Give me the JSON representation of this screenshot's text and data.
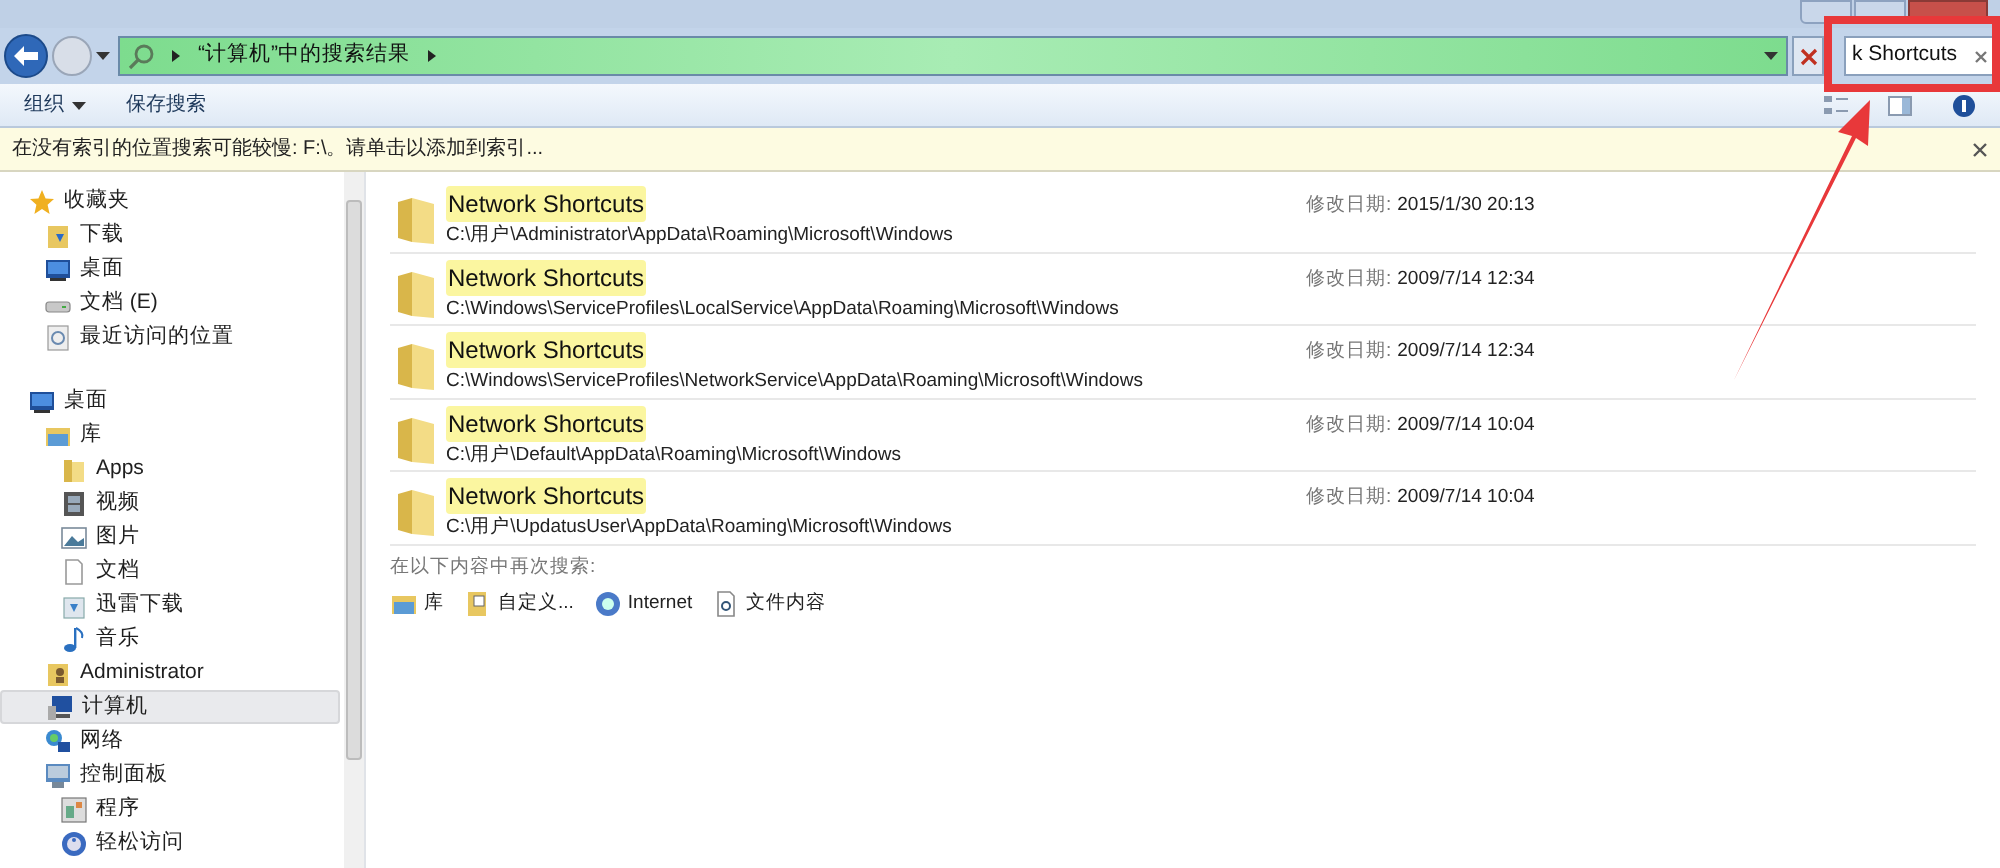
{
  "address_bar": {
    "breadcrumb": "“计算机”中的搜索结果"
  },
  "search": {
    "value": "k Shortcuts"
  },
  "toolbar": {
    "organize": "组织",
    "save_search": "保存搜索"
  },
  "info_bar": {
    "text": "在没有索引的位置搜索可能较慢: F:\\。请单击以添加到索引..."
  },
  "sidebar": {
    "items": [
      {
        "label": "收藏夹",
        "kind": "star",
        "selected": false,
        "children": [
          {
            "label": "下载",
            "kind": "download-folder",
            "selected": false
          },
          {
            "label": "桌面",
            "kind": "desktop",
            "selected": false
          },
          {
            "label": "文档 (E)",
            "kind": "drive",
            "selected": false
          },
          {
            "label": "最近访问的位置",
            "kind": "recent",
            "selected": false
          }
        ]
      },
      {
        "label": "桌面",
        "kind": "desktop",
        "selected": false,
        "children": [
          {
            "label": "库",
            "kind": "library",
            "selected": false,
            "children": [
              {
                "label": "Apps",
                "kind": "folder",
                "selected": false
              },
              {
                "label": "视频",
                "kind": "video",
                "selected": false
              },
              {
                "label": "图片",
                "kind": "picture",
                "selected": false
              },
              {
                "label": "文档",
                "kind": "document",
                "selected": false
              },
              {
                "label": "迅雷下载",
                "kind": "download",
                "selected": false
              },
              {
                "label": "音乐",
                "kind": "music",
                "selected": false
              }
            ]
          },
          {
            "label": "Administrator",
            "kind": "user",
            "selected": false
          },
          {
            "label": "计算机",
            "kind": "computer",
            "selected": true
          },
          {
            "label": "网络",
            "kind": "network",
            "selected": false
          },
          {
            "label": "控制面板",
            "kind": "control-panel",
            "selected": false,
            "children": [
              {
                "label": "程序",
                "kind": "program",
                "selected": false
              },
              {
                "label": "轻松访问",
                "kind": "accessibility",
                "selected": false
              }
            ]
          }
        ]
      }
    ]
  },
  "results": [
    {
      "name": "Network Shortcuts",
      "path": "C:\\用户\\Administrator\\AppData\\Roaming\\Microsoft\\Windows",
      "date_label": "修改日期:",
      "date": "2015/1/30 20:13"
    },
    {
      "name": "Network Shortcuts",
      "path": "C:\\Windows\\ServiceProfiles\\LocalService\\AppData\\Roaming\\Microsoft\\Windows",
      "date_label": "修改日期:",
      "date": "2009/7/14 12:34"
    },
    {
      "name": "Network Shortcuts",
      "path": "C:\\Windows\\ServiceProfiles\\NetworkService\\AppData\\Roaming\\Microsoft\\Windows",
      "date_label": "修改日期:",
      "date": "2009/7/14 12:34"
    },
    {
      "name": "Network Shortcuts",
      "path": "C:\\用户\\Default\\AppData\\Roaming\\Microsoft\\Windows",
      "date_label": "修改日期:",
      "date": "2009/7/14 10:04"
    },
    {
      "name": "Network Shortcuts",
      "path": "C:\\用户\\UpdatusUser\\AppData\\Roaming\\Microsoft\\Windows",
      "date_label": "修改日期:",
      "date": "2009/7/14 10:04"
    }
  ],
  "search_again": {
    "title": "在以下内容中再次搜索:",
    "options": [
      {
        "label": "库",
        "kind": "library"
      },
      {
        "label": "自定义...",
        "kind": "custom"
      },
      {
        "label": "Internet",
        "kind": "internet"
      },
      {
        "label": "文件内容",
        "kind": "file-content"
      }
    ]
  }
}
